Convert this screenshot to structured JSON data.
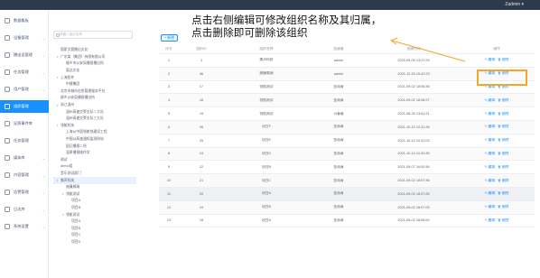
{
  "topbar": {
    "user": "Zadmin ▾"
  },
  "nav": [
    {
      "label": "数据看板",
      "arrow": "",
      "active": false
    },
    {
      "label": "设备管理",
      "arrow": "⌄",
      "active": false
    },
    {
      "label": "播出设管理",
      "arrow": "⌄",
      "active": false
    },
    {
      "label": "任务管理",
      "arrow": "⌄",
      "active": false
    },
    {
      "label": "用户管理",
      "arrow": "⌄",
      "active": false
    },
    {
      "label": "组织管理",
      "arrow": "",
      "active": true
    },
    {
      "label": "证照事件库",
      "arrow": "",
      "active": false
    },
    {
      "label": "任务管理",
      "arrow": "",
      "active": false
    },
    {
      "label": "媒体库",
      "arrow": "⌄",
      "active": false
    },
    {
      "label": "内容管理",
      "arrow": "⌄",
      "active": false
    },
    {
      "label": "告警管理",
      "arrow": "⌄",
      "active": false
    },
    {
      "label": "日志库",
      "arrow": "⌄",
      "active": false
    },
    {
      "label": "系统设置",
      "arrow": "⌄",
      "active": false
    }
  ],
  "tree": {
    "search_placeholder": "请输入组织名称",
    "nodes": [
      {
        "text": "国家文管播出文化",
        "indent": 0,
        "caret": "",
        "sel": false
      },
      {
        "text": "广东某（集团）有限有限公司",
        "indent": 0,
        "caret": "▾",
        "sel": false
      },
      {
        "text": "顺乡市公安局播报播出所",
        "indent": 1,
        "caret": "",
        "sel": false
      },
      {
        "text": "惠达文化",
        "indent": 1,
        "caret": "",
        "sel": false
      },
      {
        "text": "上海医件",
        "indent": 0,
        "caret": "▾",
        "sel": false
      },
      {
        "text": "中建集团",
        "indent": 1,
        "caret": "",
        "sel": false
      },
      {
        "text": "北京市城市应急管理服务平台",
        "indent": 0,
        "caret": "",
        "sel": false
      },
      {
        "text": "顺乡公安局播报播出所",
        "indent": 0,
        "caret": "",
        "sel": false
      },
      {
        "text": "浙江温州",
        "indent": 0,
        "caret": "▾",
        "sel": false
      },
      {
        "text": "温州高速交警支队二大队",
        "indent": 1,
        "caret": "",
        "sel": false
      },
      {
        "text": "温州高速交警支队三大队",
        "indent": 1,
        "caret": "",
        "sel": false
      },
      {
        "text": "领航科技",
        "indent": 0,
        "caret": "▾",
        "sel": false
      },
      {
        "text": "上海从中国领航快建设工程",
        "indent": 1,
        "caret": "",
        "sel": false
      },
      {
        "text": "中国从高速通知监测测站",
        "indent": 1,
        "caret": "",
        "sel": false
      },
      {
        "text": "国记播报二所",
        "indent": 1,
        "caret": "",
        "sel": false
      },
      {
        "text": "温泉播报操作学",
        "indent": 1,
        "caret": "",
        "sel": false
      },
      {
        "text": "测试",
        "indent": 0,
        "caret": "",
        "sel": false
      },
      {
        "text": "demo组",
        "indent": 0,
        "caret": "",
        "sel": false
      },
      {
        "text": "音乐测试部门",
        "indent": 0,
        "caret": "",
        "sel": false
      },
      {
        "text": "美声科技",
        "indent": 0,
        "caret": "▾",
        "sel": true
      },
      {
        "text": "施廉威瑞",
        "indent": 1,
        "caret": "",
        "sel": false
      },
      {
        "text": "领航测试",
        "indent": 1,
        "caret": "▾",
        "sel": false
      },
      {
        "text": "项目A",
        "indent": 2,
        "caret": "",
        "sel": false
      },
      {
        "text": "项目B",
        "indent": 2,
        "caret": "",
        "sel": false
      },
      {
        "text": "领航测试",
        "indent": 1,
        "caret": "▾",
        "sel": false
      },
      {
        "text": "项目A",
        "indent": 2,
        "caret": "",
        "sel": false
      },
      {
        "text": "项目B",
        "indent": 2,
        "caret": "",
        "sel": false
      },
      {
        "text": "项目C",
        "indent": 2,
        "caret": "",
        "sel": false
      },
      {
        "text": "项目D",
        "indent": 2,
        "caret": "",
        "sel": false
      }
    ]
  },
  "main": {
    "add_button": "+ 新增",
    "columns": {
      "seq": "序号",
      "id": "组织ID",
      "name": "组织名称",
      "creator": "创建者",
      "time": "创建时间",
      "op": "操作"
    },
    "edit_label": "编辑",
    "delete_label": "删除",
    "rows": [
      {
        "seq": "1",
        "id": "1",
        "name": "美声科技",
        "creator": "admin",
        "time": "2020-09-09 13:27:29"
      },
      {
        "seq": "2",
        "id": "46",
        "name": "施廉威瑞",
        "creator": "admin",
        "time": "2021-12-29 15:42:23"
      },
      {
        "seq": "3",
        "id": "17",
        "name": "领航测试",
        "creator": "金雨青",
        "time": "2021-09-02 18:06:36"
      },
      {
        "seq": "4",
        "id": "16",
        "name": "领航测试",
        "creator": "金雨青",
        "time": "2021-09-02 18:06:27"
      },
      {
        "seq": "5",
        "id": "15",
        "name": "领航测试",
        "creator": "马春春",
        "time": "2021-08-26 13:51:21"
      },
      {
        "seq": "6",
        "id": "26",
        "name": "项目F",
        "creator": "金雨青",
        "time": "2021-10-13 10:31:26"
      },
      {
        "seq": "7",
        "id": "25",
        "name": "项目E",
        "creator": "金雨青",
        "time": "2021-10-13 10:31:03"
      },
      {
        "seq": "8",
        "id": "24",
        "name": "项目D",
        "creator": "金雨青",
        "time": "2021-10-13 10:30:35"
      },
      {
        "seq": "9",
        "id": "22",
        "name": "项目B",
        "creator": "金雨青",
        "time": "2021-09-07 16:00:36"
      },
      {
        "seq": "10",
        "id": "21",
        "name": "项目C",
        "creator": "金雨青",
        "time": "2021-09-02 18:07:36"
      },
      {
        "seq": "11",
        "id": "20",
        "name": "项目A",
        "creator": "金雨青",
        "time": "2021-09-02 18:07:26"
      },
      {
        "seq": "12",
        "id": "19",
        "name": "项目B",
        "creator": "金雨青",
        "time": "2021-09-02 18:07:05"
      },
      {
        "seq": "13",
        "id": "18",
        "name": "项目A",
        "creator": "金雨青",
        "time": "2021-09-02 18:06:54"
      }
    ]
  },
  "annotation": {
    "line1": "点击右侧编辑可修改组织名称及其归属，",
    "line2": "点击删除即可删除该组织",
    "color": "#f5a623"
  }
}
